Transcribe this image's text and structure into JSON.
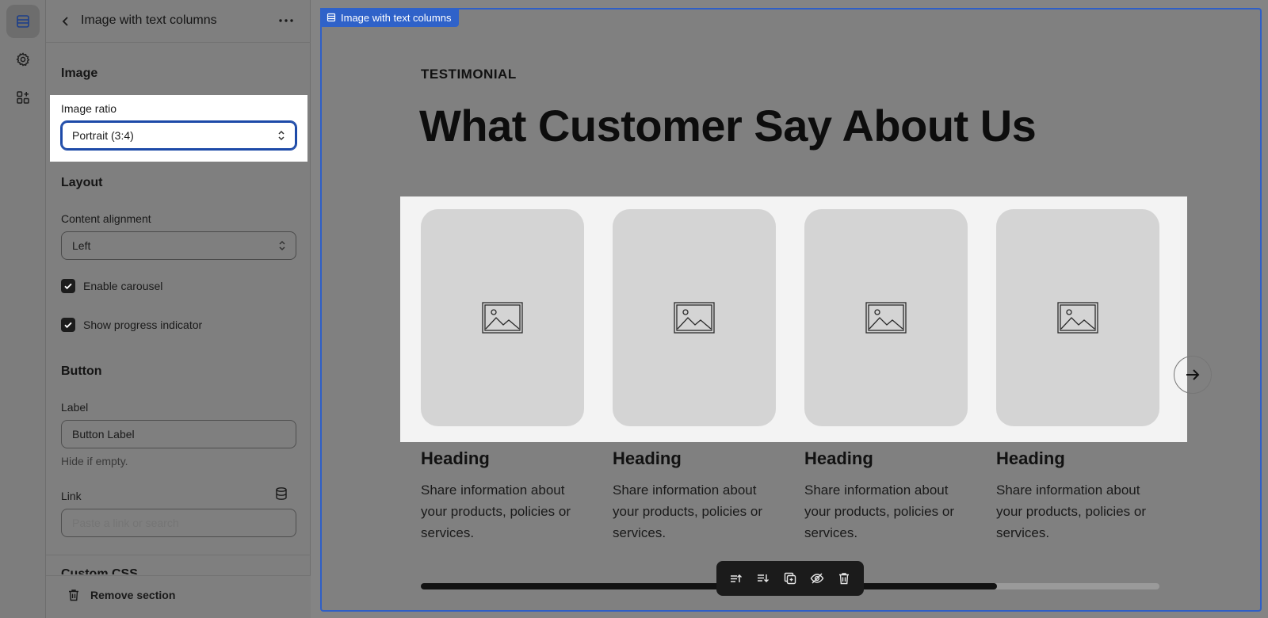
{
  "rail": {
    "items": [
      {
        "icon": "sections-icon",
        "active": true
      },
      {
        "icon": "gear-icon",
        "active": false
      },
      {
        "icon": "apps-icon",
        "active": false
      }
    ]
  },
  "panel": {
    "title": "Image with text columns",
    "image_section": {
      "title": "Image",
      "ratio_label": "Image ratio",
      "ratio_value": "Portrait (3:4)"
    },
    "layout_section": {
      "title": "Layout",
      "alignment_label": "Content alignment",
      "alignment_value": "Left",
      "carousel_label": "Enable carousel",
      "carousel_checked": true,
      "progress_label": "Show progress indicator",
      "progress_checked": true
    },
    "button_section": {
      "title": "Button",
      "label_label": "Label",
      "label_value": "Button Label",
      "label_helper": "Hide if empty.",
      "link_label": "Link",
      "link_placeholder": "Paste a link or search"
    },
    "next_section_title_cut": "Custom CSS",
    "remove_label": "Remove section"
  },
  "preview": {
    "section_tag": "Image with text columns",
    "eyebrow": "TESTIMONIAL",
    "headline": "What Customer Say About Us",
    "cards": [
      {
        "heading": "Heading",
        "text": "Share information about your products, policies or services."
      },
      {
        "heading": "Heading",
        "text": "Share information about your products, policies or services."
      },
      {
        "heading": "Heading",
        "text": "Share information about your products, policies or services."
      },
      {
        "heading": "Heading",
        "text": "Share information about your products, policies or services."
      }
    ],
    "progress": 0.78,
    "toolbar": [
      "move-up-icon",
      "move-down-icon",
      "duplicate-icon",
      "hide-icon",
      "delete-icon"
    ]
  },
  "colors": {
    "selection_blue": "#2f62c9",
    "focus_blue": "#1d4aa8",
    "toolbar_bg": "#1b1b1b",
    "placeholder_gray": "#d4d4d4"
  }
}
